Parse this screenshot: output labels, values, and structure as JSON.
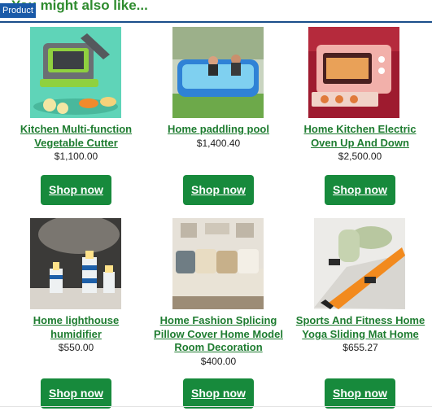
{
  "header": {
    "tag": "Product",
    "title": "You might also like..."
  },
  "products": [
    {
      "name": "Kitchen Multi-function Vegetable Cutter",
      "price": "$1,100.00",
      "button": "Shop now"
    },
    {
      "name": "Home paddling pool",
      "price": "$1,400.40",
      "button": "Shop now"
    },
    {
      "name": "Home Kitchen Electric Oven Up And Down",
      "price": "$2,500.00",
      "button": "Shop now"
    },
    {
      "name": "Home lighthouse humidifier",
      "price": "$550.00",
      "button": "Shop now"
    },
    {
      "name": "Home Fashion Splicing Pillow Cover Home Model Room Decoration",
      "price": "$400.00",
      "button": "Shop now"
    },
    {
      "name": "Sports And Fitness Home Yoga Sliding Mat Home",
      "price": "$655.27",
      "button": "Shop now"
    }
  ]
}
